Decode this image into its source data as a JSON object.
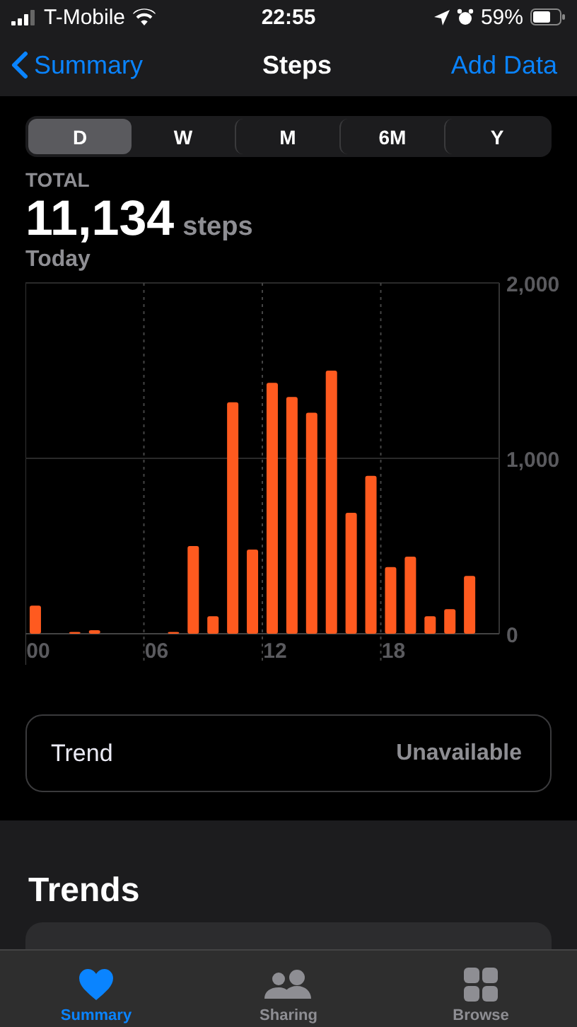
{
  "status_bar": {
    "carrier": "T-Mobile",
    "time": "22:55",
    "battery": "59%"
  },
  "nav": {
    "back": "Summary",
    "title": "Steps",
    "action": "Add Data"
  },
  "segments": [
    {
      "label": "D",
      "selected": true
    },
    {
      "label": "W",
      "selected": false
    },
    {
      "label": "M",
      "selected": false
    },
    {
      "label": "6M",
      "selected": false
    },
    {
      "label": "Y",
      "selected": false
    }
  ],
  "summary": {
    "label": "TOTAL",
    "value": "11,134",
    "unit": "steps",
    "period": "Today"
  },
  "chart": {
    "chart_data": {
      "type": "bar",
      "x": [
        0,
        1,
        2,
        3,
        4,
        5,
        6,
        7,
        8,
        9,
        10,
        11,
        12,
        13,
        14,
        15,
        16,
        17,
        18,
        19,
        20,
        21,
        22,
        23
      ],
      "xlim": [
        -0.5,
        23.5
      ],
      "series": [
        {
          "color": "#ff5a1f",
          "values": [
            160,
            0,
            10,
            20,
            0,
            0,
            0,
            10,
            500,
            100,
            1320,
            480,
            1430,
            1350,
            1260,
            1500,
            690,
            900,
            380,
            440,
            100,
            140,
            330,
            0
          ]
        }
      ],
      "ylim": [
        0,
        2000
      ],
      "xticks": [
        {
          "value": 0,
          "label": "00"
        },
        {
          "value": 6,
          "label": "06"
        },
        {
          "value": 12,
          "label": "12"
        },
        {
          "value": 18,
          "label": "18"
        }
      ],
      "yticks": [
        {
          "value": 0,
          "label": "0"
        },
        {
          "value": 1000,
          "label": "1,000"
        },
        {
          "value": 2000,
          "label": "2,000"
        }
      ]
    }
  },
  "trend": {
    "label": "Trend",
    "value": "Unavailable"
  },
  "trends": {
    "title": "Trends"
  },
  "tab_bar": [
    {
      "label": "Summary",
      "selected": true
    },
    {
      "label": "Sharing",
      "selected": false
    },
    {
      "label": "Browse",
      "selected": false
    }
  ]
}
